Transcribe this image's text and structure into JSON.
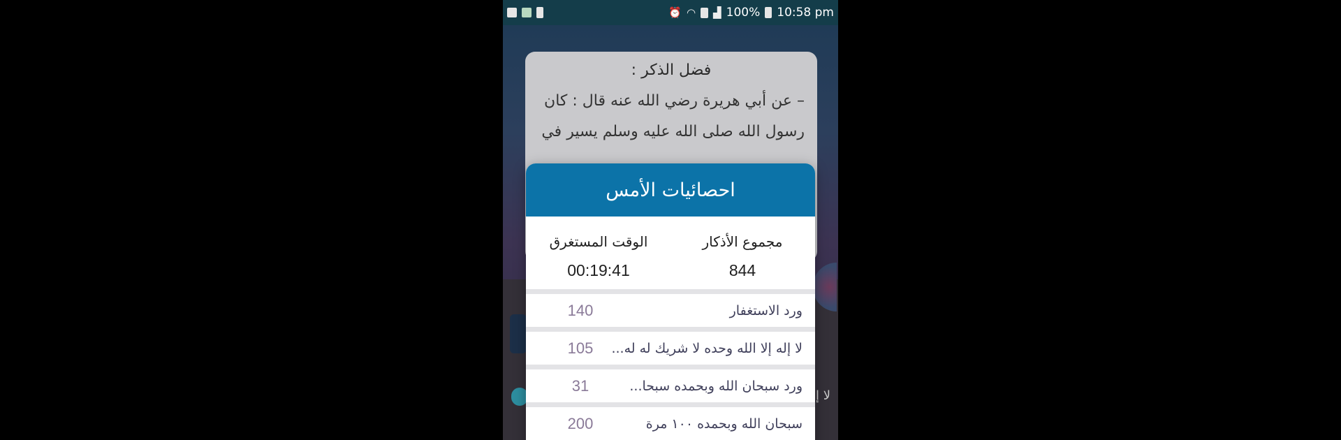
{
  "status_bar": {
    "battery_percent": "100%",
    "time": "10:58 pm",
    "left_icons": [
      "image-icon",
      "app-icon",
      "battery-saver-icon"
    ],
    "right_icons": [
      "alarm-icon",
      "wifi-icon",
      "sim-icon",
      "signal-icon",
      "battery-icon"
    ]
  },
  "background_card": {
    "title": "فضل الذكر :",
    "lines": [
      "– عن أبي هريرة رضي الله عنه قال : كان",
      "رسول الله صلى الله عليه وسلم يسير في"
    ]
  },
  "background_right_text": "لا إ",
  "dialog": {
    "title": "احصائيات الأمس",
    "stats": {
      "total_label": "مجموع الأذكار",
      "total_value": "844",
      "time_label": "الوقت المستغرق",
      "time_value": "00:19:41"
    },
    "rows": [
      {
        "name": "ورد الاستغفار",
        "count": "140"
      },
      {
        "name": "لا إله إلا الله وحده لا شريك له له...",
        "count": "105"
      },
      {
        "name": "ورد سبحان الله وبحمده سبحا...",
        "count": "31"
      },
      {
        "name": "سبحان الله وبحمده ١٠٠ مرة",
        "count": "200"
      }
    ]
  },
  "colors": {
    "header": "#0c73a8",
    "status_bar": "#143d4a",
    "count_text": "#8a7a98"
  }
}
